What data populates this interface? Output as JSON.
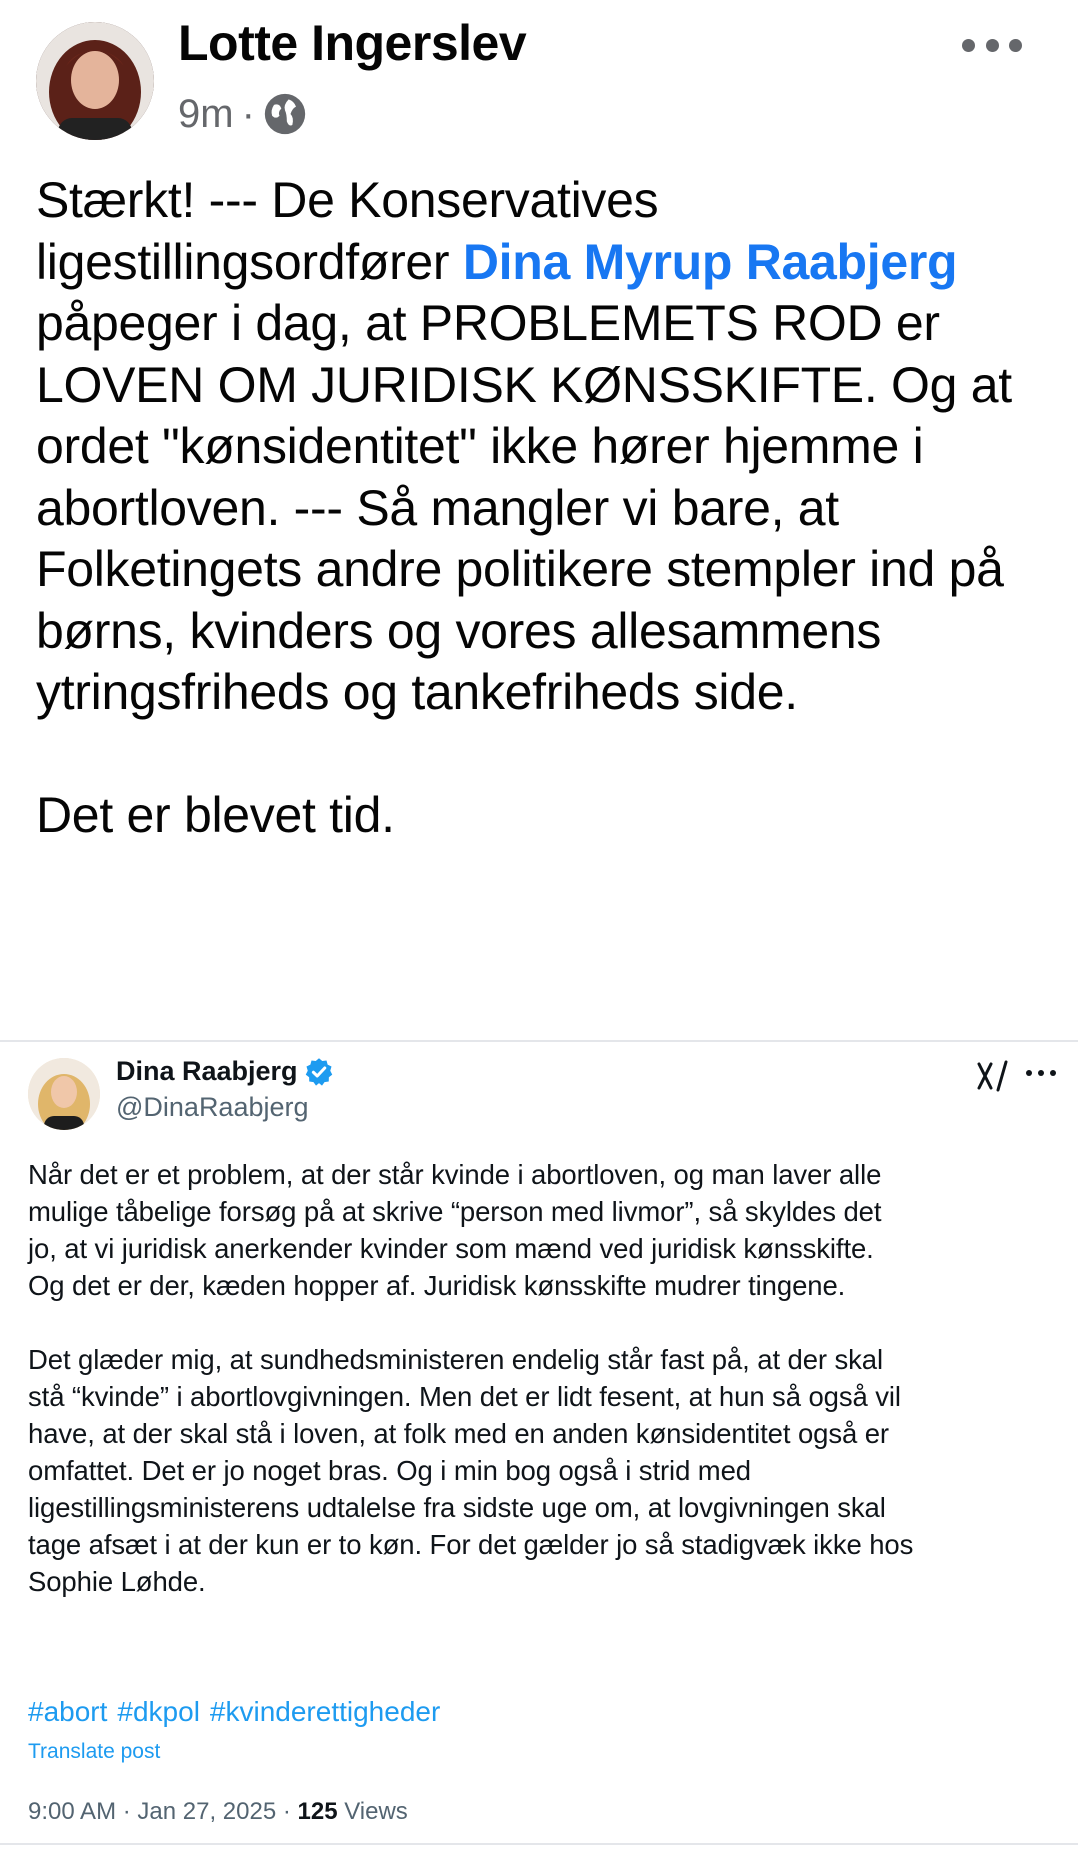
{
  "post": {
    "author": "Lotte Ingerslev",
    "time": "9m",
    "separator": "·",
    "audience_icon": "globe-icon",
    "more_icon": "more-icon",
    "text_part1": "Stærkt! --- De Konservatives ligestillingsordfører ",
    "mention": "Dina Myrup Raabjerg",
    "text_part2": " påpeger i dag, at PROBLEMETS ROD er LOVEN OM JURIDISK KØNSSKIFTE. Og at ordet \"kønsidentitet\" ikke hører hjemme i abortloven. --- Så mangler vi bare, at Folketingets andre politikere stempler ind på børns, kvinders og vores allesammens ytringsfriheds og tankefriheds side.",
    "closing": "Det er blevet tid."
  },
  "tweet": {
    "name": "Dina Raabjerg",
    "handle": "@DinaRaabjerg",
    "paragraph1_lines": [
      "Når det er et problem, at der står kvinde i abortloven, og man laver alle",
      "mulige tåbelige forsøg på at skrive “person med livmor”, så skyldes det",
      "jo, at vi juridisk anerkender kvinder som mænd ved juridisk kønsskifte.",
      "Og det er der, kæden hopper af. Juridisk kønsskifte mudrer tingene."
    ],
    "paragraph2_lines": [
      "Det glæder mig, at sundhedsministeren endelig står fast på, at der skal",
      "stå “kvinde” i abortlovgivningen. Men det er lidt fesent, at hun så også vil",
      "have, at der skal stå i loven, at folk med en anden kønsidentitet også er",
      "omfattet. Det er jo noget bras. Og i min bog også i strid med",
      "ligestillingsministerens udtalelse fra sidste uge om, at lovgivningen skal",
      "tage afsæt i at der kun er to køn. For det gælder jo så stadigvæk ikke hos",
      "Sophie Løhde."
    ],
    "hashtags": [
      "#abort",
      "#dkpol",
      "#kvinderettigheder"
    ],
    "translate_label": "Translate post",
    "timestamp": "9:00 AM · Jan 27, 2025 · ",
    "views_count": "125",
    "views_label": " Views",
    "colors": {
      "link": "#1d9bf0",
      "verified": "#1d9bf0",
      "fb_mention": "#1877f2"
    }
  }
}
